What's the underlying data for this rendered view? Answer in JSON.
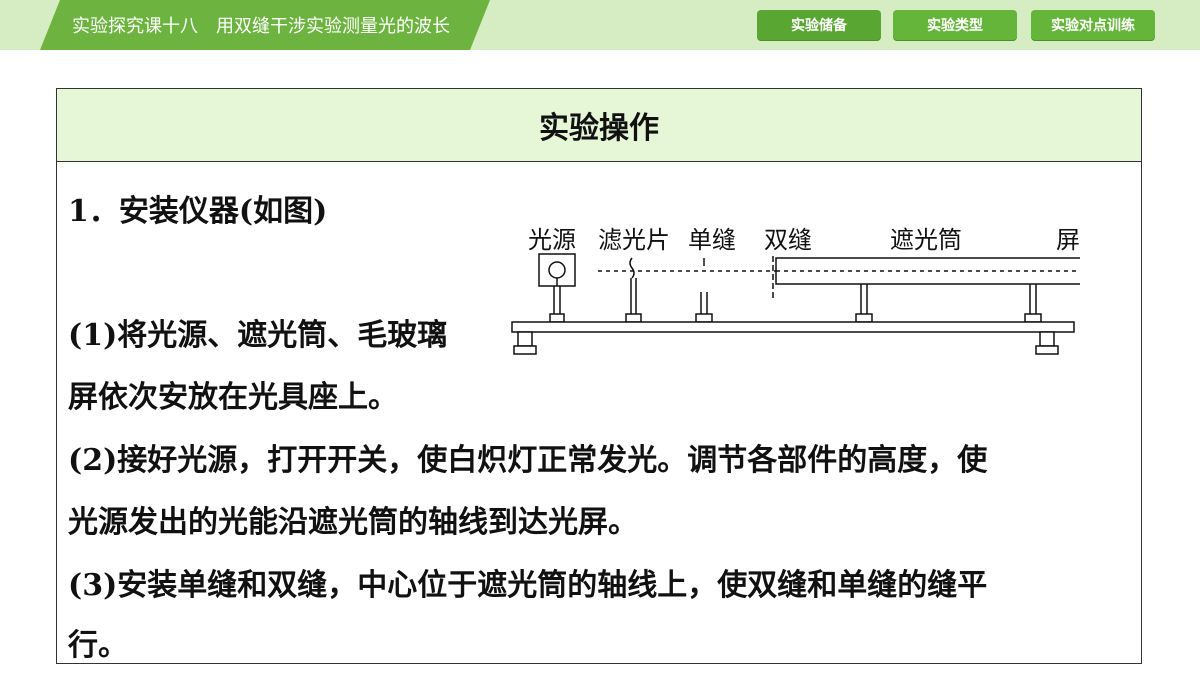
{
  "header": {
    "title": "实验探究课十八　用双缝干涉实验测量光的波长",
    "nav": [
      "实验储备",
      "实验类型",
      "实验对点训练"
    ]
  },
  "section": {
    "heading": "实验操作"
  },
  "content": {
    "item1": "1．安装仪器(如图)",
    "p1_line1": "(1)将光源、遮光筒、毛玻璃",
    "p1_line2": "屏依次安放在光具座上。",
    "p2_line1": "(2)接好光源，打开开关，使白炽灯正常发光。调节各部件的高度，使",
    "p2_line2": "光源发出的光能沿遮光筒的轴线到达光屏。",
    "p3_line1": "(3)安装单缝和双缝，中心位于遮光筒的轴线上，使双缝和单缝的缝平",
    "p3_line2": "行。"
  },
  "diagram": {
    "labels": {
      "light_source": "光源",
      "filter": "滤光片",
      "single_slit": "单缝",
      "double_slit": "双缝",
      "tube": "遮光筒",
      "screen": "屏"
    }
  }
}
